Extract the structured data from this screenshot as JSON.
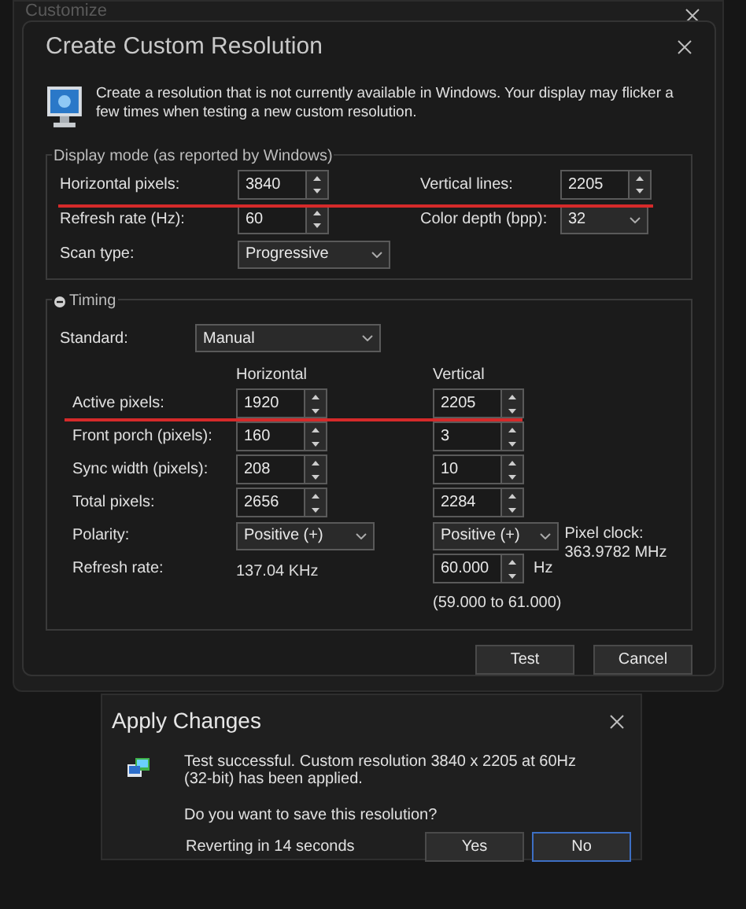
{
  "background_window": {
    "title": "Customize"
  },
  "dialog": {
    "title": "Create Custom Resolution",
    "description": "Create a resolution that is not currently available in Windows. Your display may flicker a few times when testing a new custom resolution.",
    "display_mode": {
      "legend": "Display mode (as reported by Windows)",
      "rows": [
        [
          {
            "label": "Horizontal pixels:",
            "kind": "spin",
            "value": "3840"
          },
          {
            "label": "Vertical lines:",
            "kind": "spin",
            "value": "2205"
          }
        ],
        [
          {
            "label": "Refresh rate (Hz):",
            "kind": "spin",
            "value": "60"
          },
          {
            "label": "Color depth (bpp):",
            "kind": "dropdown",
            "value": "32"
          }
        ],
        [
          {
            "label": "Scan type:",
            "kind": "dropdown",
            "value": "Progressive"
          }
        ]
      ]
    },
    "timing": {
      "legend": "Timing",
      "expanded": true,
      "standard": {
        "label": "Standard:",
        "value": "Manual"
      },
      "columns": [
        "Horizontal",
        "Vertical"
      ],
      "rows": [
        {
          "label": "Active pixels:",
          "horizontal": {
            "kind": "spin",
            "value": "1920"
          },
          "vertical": {
            "kind": "spin",
            "value": "2205"
          }
        },
        {
          "label": "Front porch (pixels):",
          "horizontal": {
            "kind": "spin",
            "value": "160"
          },
          "vertical": {
            "kind": "spin",
            "value": "3"
          }
        },
        {
          "label": "Sync width (pixels):",
          "horizontal": {
            "kind": "spin",
            "value": "208"
          },
          "vertical": {
            "kind": "spin",
            "value": "10"
          }
        },
        {
          "label": "Total pixels:",
          "horizontal": {
            "kind": "spin",
            "value": "2656"
          },
          "vertical": {
            "kind": "spin",
            "value": "2284"
          }
        },
        {
          "label": "Polarity:",
          "horizontal": {
            "kind": "dropdown",
            "value": "Positive (+)"
          },
          "vertical": {
            "kind": "dropdown",
            "value": "Positive (+)"
          }
        },
        {
          "label": "Refresh rate:",
          "horizontal": {
            "kind": "text",
            "value": "137.04 KHz"
          },
          "vertical": {
            "kind": "spin",
            "value": "60.000",
            "unit": "Hz"
          }
        }
      ],
      "range": "(59.000 to 61.000)",
      "pixel_clock": {
        "label": "Pixel clock:",
        "value": "363.9782 MHz"
      }
    },
    "buttons": [
      {
        "label": "Test",
        "focused": false
      },
      {
        "label": "Cancel",
        "focused": false
      }
    ]
  },
  "apply_dialog": {
    "title": "Apply Changes",
    "message": "Test successful. Custom resolution 3840 x 2205 at 60Hz (32-bit) has been applied.",
    "question": "Do you want to save this resolution?",
    "countdown": "Reverting in 14 seconds",
    "buttons": [
      {
        "label": "Yes",
        "focused": false
      },
      {
        "label": "No",
        "focused": true
      }
    ]
  }
}
